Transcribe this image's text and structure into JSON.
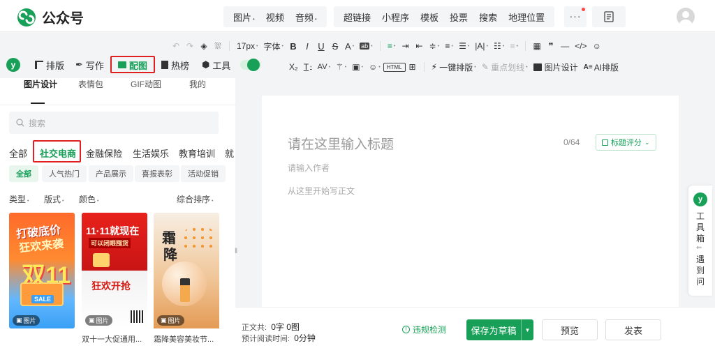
{
  "app": {
    "name": "公众号",
    "brand_color": "#18a058",
    "accent_red": "#e02020"
  },
  "insert_menu": {
    "group1": [
      {
        "label": "图片",
        "dropdown": true
      },
      {
        "label": "视频",
        "dropdown": false
      },
      {
        "label": "音频",
        "dropdown": true
      }
    ],
    "group2": [
      {
        "label": "超链接"
      },
      {
        "label": "小程序"
      },
      {
        "label": "模板"
      },
      {
        "label": "投票"
      },
      {
        "label": "搜索"
      },
      {
        "label": "地理位置"
      }
    ],
    "more": "···"
  },
  "toolbar": {
    "font_size": "17px",
    "font_family": "字体",
    "one_click_layout": "一键排版",
    "key_underline": "重点划线",
    "image_design": "图片设计",
    "ai_layout": "AI排版"
  },
  "plugin_bar": {
    "items": [
      {
        "label": "排版",
        "icon": "layout-icon"
      },
      {
        "label": "写作",
        "icon": "pen-icon"
      },
      {
        "label": "配图",
        "icon": "image-icon",
        "active": true
      },
      {
        "label": "热榜",
        "icon": "bookmark-icon"
      },
      {
        "label": "工具",
        "icon": "cube-icon"
      }
    ]
  },
  "panel": {
    "tabs": [
      "图片设计",
      "表情包",
      "GIF动图",
      "我的"
    ],
    "search_placeholder": "搜索",
    "categories": [
      "全部",
      "社交电商",
      "金融保险",
      "生活娱乐",
      "教育培训",
      "就"
    ],
    "active_category": "社交电商",
    "chips": [
      "全部",
      "人气热门",
      "产品展示",
      "喜报表彰",
      "活动促销"
    ],
    "filters": [
      "类型",
      "版式",
      "颜色"
    ],
    "sort": "综合排序",
    "cards": [
      {
        "caption": "",
        "badge": "图片",
        "poster_text_1": "打破底价",
        "poster_text_2": "狂欢来袭",
        "poster_text_3": "双11"
      },
      {
        "caption": "双十一大促通用...",
        "badge": "图片",
        "poster_text_1": "11·11就现在",
        "poster_text_2": "可以闭眼囤货",
        "poster_text_3": "狂欢开抢"
      },
      {
        "caption": "霜降美容美妆节...",
        "badge": "图片",
        "poster_text_1": "霜",
        "poster_text_2": "降"
      }
    ]
  },
  "editor": {
    "title_placeholder": "请在这里输入标题",
    "title_count": "0/64",
    "title_score": "标题评分",
    "author_placeholder": "请输入作者",
    "body_placeholder": "从这里开始写正文"
  },
  "toolbox": {
    "label_top": "工具箱",
    "label_bottom": "遇到问题"
  },
  "bottom": {
    "word_count_label": "正文共:",
    "word_count_value": "0字 0图",
    "read_time_label": "预计阅读时间:",
    "read_time_value": "0分钟",
    "check": "违规检测",
    "save_draft": "保存为草稿",
    "preview": "预览",
    "publish": "发表"
  }
}
